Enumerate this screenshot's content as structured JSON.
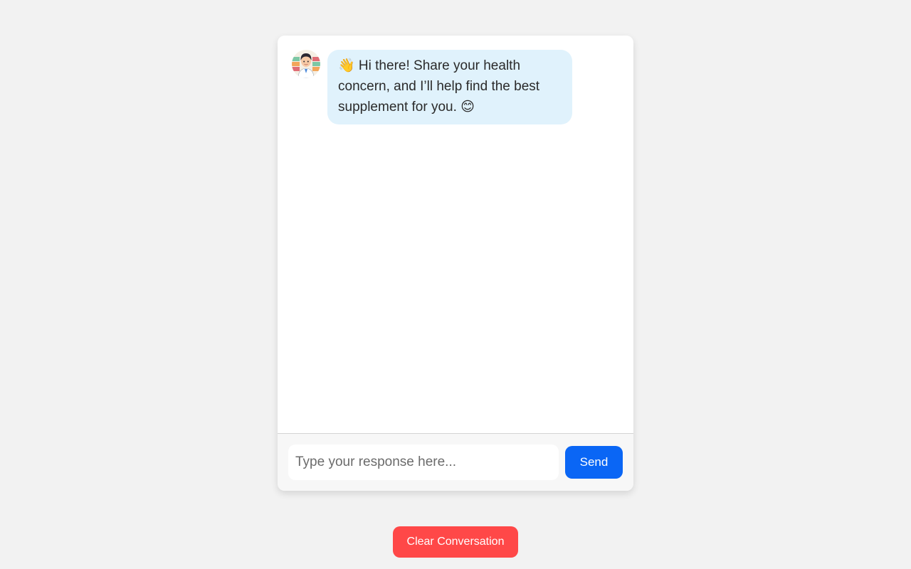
{
  "chat": {
    "avatar_icon": "pharmacist-avatar-icon",
    "messages": [
      {
        "sender": "bot",
        "text": "👋 Hi there! Share your health concern, and I’ll help find the best supplement for you. 😊"
      }
    ]
  },
  "input": {
    "placeholder": "Type your response here...",
    "value": ""
  },
  "buttons": {
    "send_label": "Send",
    "clear_label": "Clear Conversation"
  },
  "colors": {
    "page_background": "#f2f2f2",
    "bot_bubble": "#e0f2fc",
    "send_button": "#0a66f5",
    "clear_button": "#ff4848"
  }
}
